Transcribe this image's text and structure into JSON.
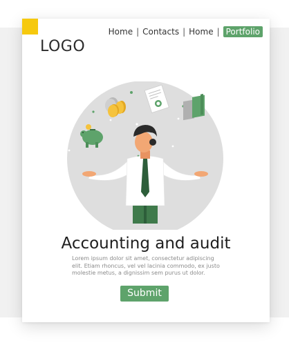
{
  "header": {
    "logo_text": "LOGO",
    "nav": [
      {
        "label": "Home"
      },
      {
        "label": "Contacts"
      },
      {
        "label": "Home"
      },
      {
        "label": "Portfolio"
      }
    ],
    "nav_separator": "|"
  },
  "hero": {
    "title": "Accounting and audit",
    "body": "Lorem ipsum dolor sit amet, consectetur adipiscing elit. Etiam rhoncus, vel vel lacinia commodo, ex justo molestie metus, a dignissim sem purus ut dolor.",
    "submit_label": "Submit"
  },
  "colors": {
    "accent_green": "#5ea36b",
    "logo_yellow": "#f6c90e",
    "circle_gray": "#dedede"
  },
  "icons": {
    "coins": "coins-icon",
    "document": "document-icon",
    "piggy_bank": "piggy-bank-icon",
    "money_stack": "money-stack-icon"
  }
}
